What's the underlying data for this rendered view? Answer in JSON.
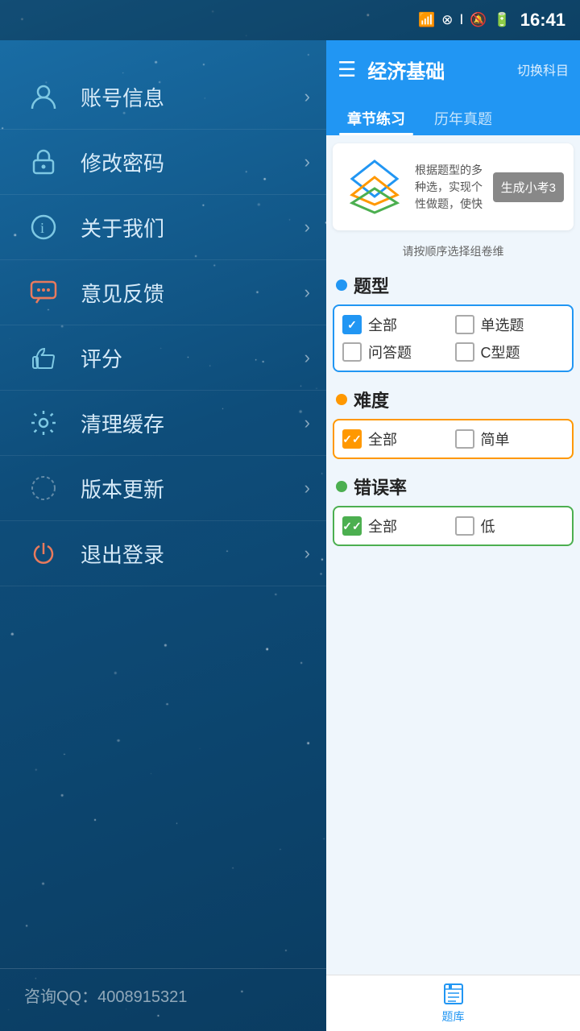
{
  "statusBar": {
    "time": "16:41"
  },
  "sidebar": {
    "menuItems": [
      {
        "id": "account",
        "label": "账号信息",
        "iconType": "user"
      },
      {
        "id": "password",
        "label": "修改密码",
        "iconType": "lock"
      },
      {
        "id": "about",
        "label": "关于我们",
        "iconType": "info"
      },
      {
        "id": "feedback",
        "label": "意见反馈",
        "iconType": "chat"
      },
      {
        "id": "rate",
        "label": "评分",
        "iconType": "thumb"
      },
      {
        "id": "cache",
        "label": "清理缓存",
        "iconType": "gear"
      },
      {
        "id": "update",
        "label": "版本更新",
        "iconType": "circle-check"
      },
      {
        "id": "logout",
        "label": "退出登录",
        "iconType": "power"
      }
    ],
    "footer": "咨询QQ：4008915321"
  },
  "rightPanel": {
    "header": {
      "title": "经济基础",
      "switchLabel": "切换科目"
    },
    "tabs": [
      {
        "id": "chapter",
        "label": "章节练习",
        "active": true
      },
      {
        "id": "past",
        "label": "历年真题",
        "active": false
      }
    ],
    "quizCard": {
      "description": "根据题型的多种选，实现个性做题，使快",
      "buttonLabel": "生成小考3"
    },
    "hintText": "请按顺序选择组卷维",
    "sections": [
      {
        "id": "type",
        "dotColor": "blue",
        "title": "题型",
        "options": [
          {
            "id": "all",
            "label": "全部",
            "checked": true
          },
          {
            "id": "single",
            "label": "单选题",
            "checked": false
          },
          {
            "id": "qa",
            "label": "问答题",
            "checked": false
          },
          {
            "id": "ctype",
            "label": "C型题",
            "checked": false
          }
        ],
        "borderClass": "blue-border"
      },
      {
        "id": "difficulty",
        "dotColor": "orange",
        "title": "难度",
        "options": [
          {
            "id": "all",
            "label": "全部",
            "checked": true
          },
          {
            "id": "easy",
            "label": "简单",
            "checked": false
          }
        ],
        "borderClass": "orange-border"
      },
      {
        "id": "errorrate",
        "dotColor": "green",
        "title": "错误率",
        "options": [
          {
            "id": "all",
            "label": "全部",
            "checked": true
          },
          {
            "id": "low",
            "label": "低",
            "checked": false
          }
        ],
        "borderClass": "green-border"
      }
    ],
    "bottomNav": [
      {
        "id": "question-bank",
        "label": "题库",
        "iconType": "book"
      }
    ]
  }
}
